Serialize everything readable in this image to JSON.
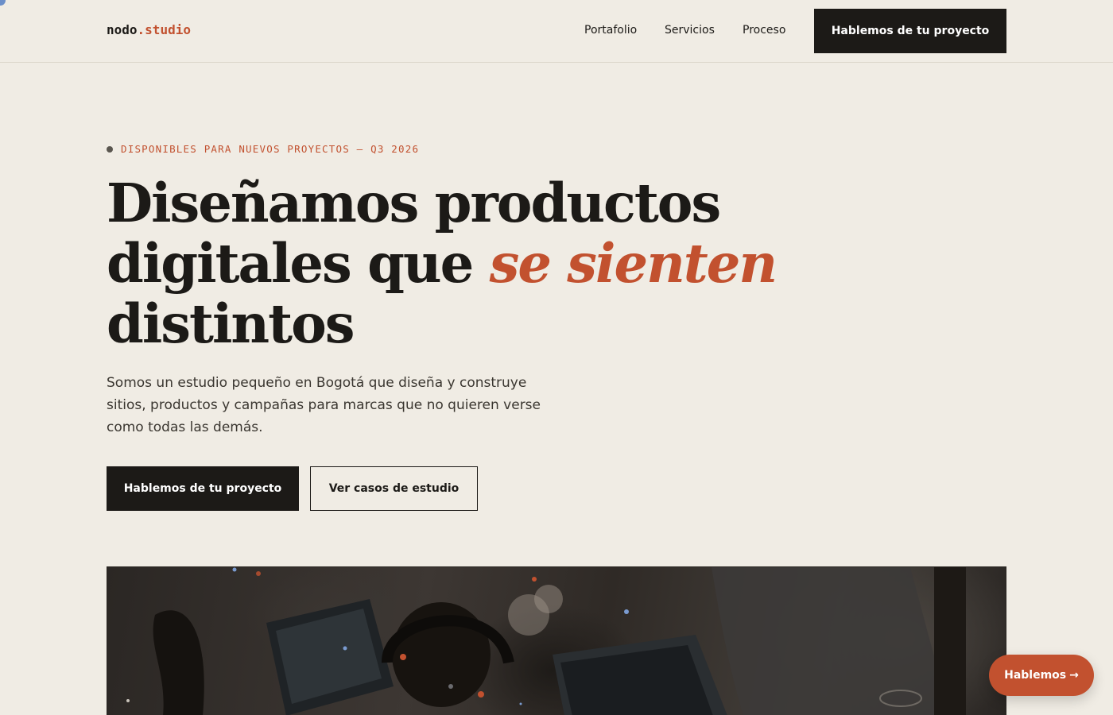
{
  "header": {
    "logo": {
      "brand": "nodo",
      "dot": ".",
      "suffix": "studio"
    },
    "nav": [
      {
        "label": "Portafolio"
      },
      {
        "label": "Servicios"
      },
      {
        "label": "Proceso"
      }
    ],
    "cta_label": "Hablemos de tu proyecto"
  },
  "hero": {
    "eyebrow": "DISPONIBLES PARA NUEVOS PROYECTOS — Q3 2026",
    "headline": {
      "part1": "Diseñamos productos digitales que",
      "accent": "se sienten",
      "part2": "distintos"
    },
    "lead": "Somos un estudio pequeño en Bogotá que diseña y construye sitios, productos y campañas para marcas que no quieren verse como todas las demás.",
    "primary_button": "Hablemos de tu proyecto",
    "secondary_button": "Ver casos de estudio"
  },
  "floating_cta": {
    "label": "Hablemos",
    "arrow": "→"
  },
  "colors": {
    "background": "#f0ece4",
    "ink": "#1c1a17",
    "accent": "#c2512f"
  },
  "icons": {
    "floating_arrow": "arrow-right-icon",
    "eyebrow_bullet": "status-dot-icon"
  }
}
